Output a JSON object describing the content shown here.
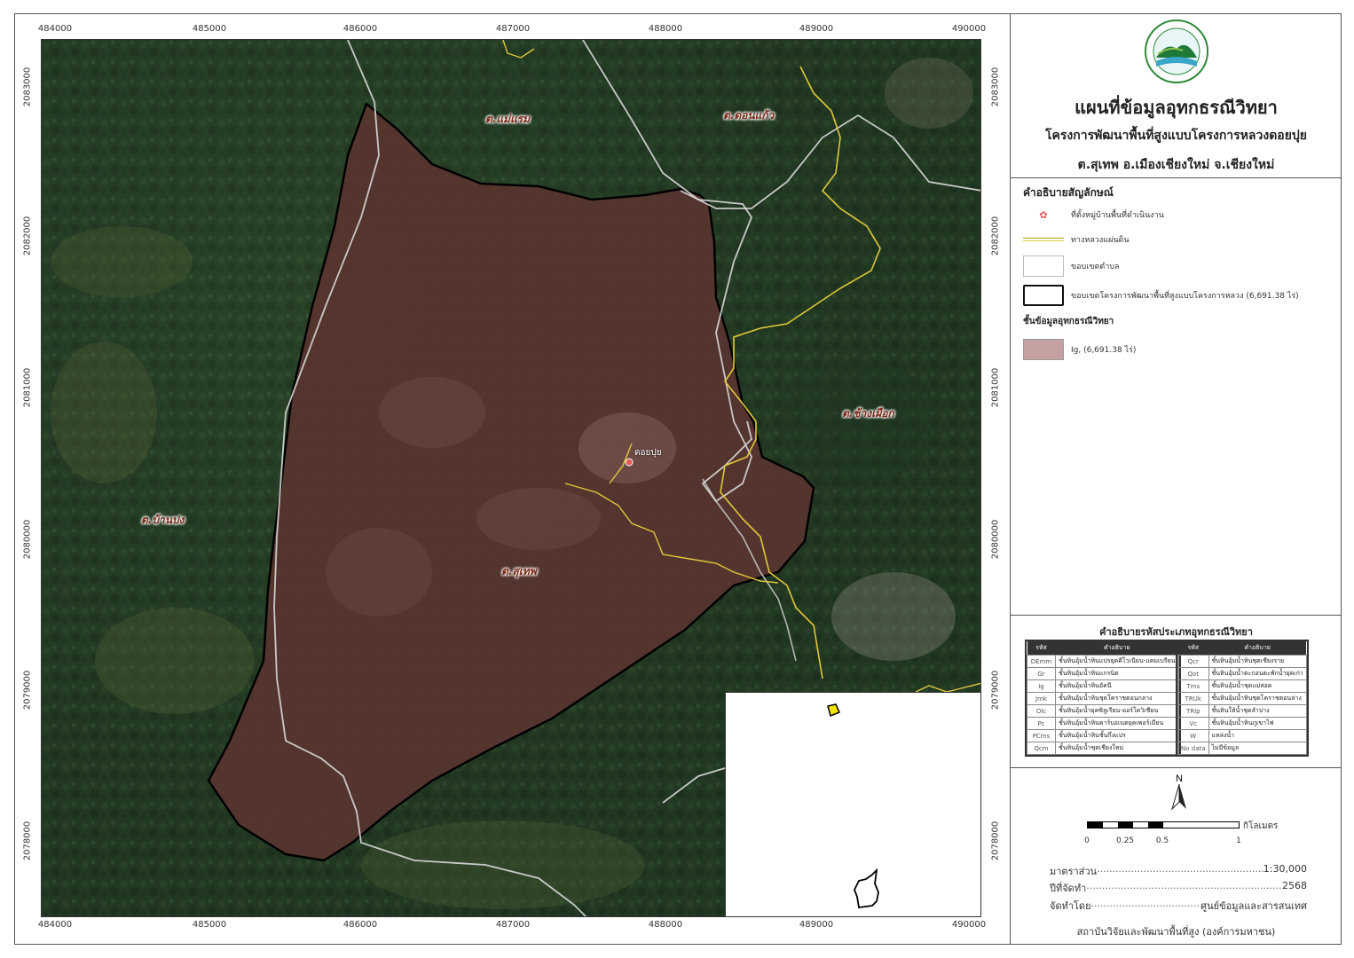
{
  "title": {
    "main": "แผนที่ข้อมูลอุทกธรณีวิทยา",
    "project": "โครงการพัฒนาพื้นที่สูงแบบโครงการหลวงดอยปุย",
    "location": "ต.สุเทพ อ.เมืองเชียงใหม่ จ.เชียงใหม่"
  },
  "grid": {
    "x_ticks": [
      "484000",
      "485000",
      "486000",
      "487000",
      "488000",
      "489000",
      "490000"
    ],
    "y_ticks": [
      "2083000",
      "2082000",
      "2081000",
      "2080000",
      "2079000",
      "2078000"
    ]
  },
  "map_labels": {
    "mae_raem": "ต.แม่แรม",
    "don_kaeo": "ต.ดอนแก้ว",
    "chang_phueak": "ต.ช้างเผือก",
    "ban_pong": "ต.บ้านปง",
    "suthep": "ต.สุเทพ",
    "village": "ดอยปุย"
  },
  "legend": {
    "title": "คำอธิบายสัญลักษณ์",
    "village_point": "ที่ตั้งหมู่บ้านพื้นที่ดำเนินงาน",
    "highway": "ทางหลวงแผ่นดิน",
    "subdistrict_boundary": "ขอบเขตตำบล",
    "project_boundary": "ขอบเขตโครงการพัฒนาพื้นที่สูงแบบโครงการหลวง (6,691.38 ไร่)",
    "layer_title": "ชั้นข้อมูลอุทกธรณีวิทยา",
    "layer_ig": "Ig, (6,691.38 ไร่)",
    "colors": {
      "ig_fill": "#c4a0a0",
      "highway": "#d8c23a",
      "boundary": "#111111"
    }
  },
  "code_table": {
    "title": "คำอธิบายรหัสประเภทอุทกธรณีวิทยา",
    "header_code": "รหัส",
    "header_desc": "คำอธิบาย",
    "left": [
      {
        "code": "DEmm",
        "desc": "ชั้นหินอุ้มน้ำหินแปรยุคดีโวเนียน-แคมเบรียน"
      },
      {
        "code": "Gr",
        "desc": "ชั้นหินอุ้มน้ำหินแกรนิต"
      },
      {
        "code": "Ig",
        "desc": "ชั้นหินอุ้มน้ำหินอัคนี"
      },
      {
        "code": "Jmk",
        "desc": "ชั้นหินอุ้มน้ำหินชุดโคราชตอนกลาง"
      },
      {
        "code": "Olc",
        "desc": "ชั้นหินอุ้มน้ำยุคซิลูเรียน-ออร์โดวิเชียน"
      },
      {
        "code": "Pc",
        "desc": "ชั้นหินอุ้มน้ำหินคาร์บอเนตยุคเพอร์เมียน"
      },
      {
        "code": "PCms",
        "desc": "ชั้นหินอุ้มน้ำหินชั้นกึ่งแปร"
      },
      {
        "code": "Qcm",
        "desc": "ชั้นหินอุ้มน้ำชุดเชียงใหม่"
      }
    ],
    "right": [
      {
        "code": "Qcr",
        "desc": "ชั้นหินอุ้มน้ำหินชุดเชียงราย"
      },
      {
        "code": "Qot",
        "desc": "ชั้นหินอุ้มน้ำตะกอนตะพักน้ำยุคเก่า"
      },
      {
        "code": "Tms",
        "desc": "ชั้นหินอุ้มน้ำชุดแม่สอด"
      },
      {
        "code": "TRUk",
        "desc": "ชั้นหินอุ้มน้ำหินชุดโคราชตอนล่าง"
      },
      {
        "code": "TRlp",
        "desc": "ชั้นหินให้น้ำชุดลำปาง"
      },
      {
        "code": "Vc",
        "desc": "ชั้นหินอุ้มน้ำหินภูเขาไฟ"
      },
      {
        "code": "W",
        "desc": "แหล่งน้ำ"
      },
      {
        "code": "No data",
        "desc": "ไม่มีข้อมูล"
      }
    ]
  },
  "scale_bar": {
    "labels": [
      "0",
      "0.25",
      "0.5",
      "1"
    ],
    "unit": "กิโลเมตร",
    "north": "N"
  },
  "info": {
    "scale_label": "มาตราส่วน",
    "scale_value": "1:30,000",
    "year_label": "ปีที่จัดทำ",
    "year_value": "2568",
    "by_label": "จัดทำโดย",
    "by_value": "ศูนย์ข้อมูลและสารสนเทศ"
  },
  "footer": "สถาบันวิจัยและพัฒนาพื้นที่สูง (องค์การมหาชน)"
}
